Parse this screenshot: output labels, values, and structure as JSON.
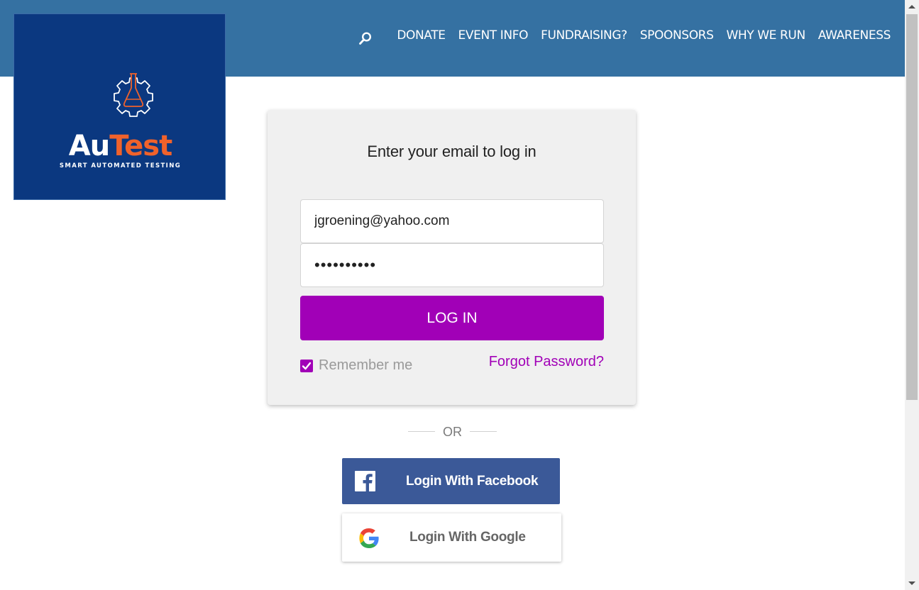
{
  "header": {
    "nav": [
      "DONATE",
      "EVENT INFO",
      "FUNDRAISING?",
      "SPOONSORS",
      "WHY WE RUN",
      "AWARENESS"
    ],
    "search_icon": "search-icon"
  },
  "logo": {
    "word_part1": "Au",
    "word_part2": "Test",
    "tagline": "SMART AUTOMATED TESTING",
    "icon": "gear-flask-icon"
  },
  "login": {
    "title": "Enter your email to log in",
    "email_value": "jgroening@yahoo.com",
    "password_value": "••••••••••",
    "login_button": "LOG IN",
    "remember_label": "Remember me",
    "remember_checked": true,
    "forgot_link": "Forgot Password?"
  },
  "divider": {
    "text": "OR"
  },
  "social": {
    "facebook_label": "Login With Facebook",
    "google_label": "Login With Google"
  },
  "colors": {
    "header_bg": "#3571a2",
    "logo_bg": "#0b3880",
    "logo_accent": "#f0622b",
    "accent": "#a100b7",
    "facebook": "#3b5998"
  }
}
